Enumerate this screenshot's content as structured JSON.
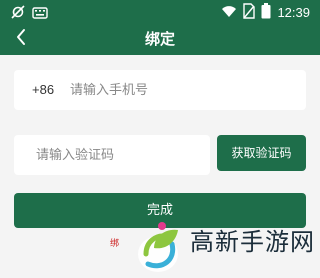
{
  "status_bar": {
    "time": "12:39",
    "icons": [
      "sync-off-icon",
      "keyboard-icon",
      "wifi-icon",
      "no-sim-icon",
      "battery-icon"
    ]
  },
  "app_bar": {
    "title": "绑定",
    "back_icon": "chevron-left-icon"
  },
  "phone_field": {
    "prefix": "+86",
    "placeholder": "请输入手机号",
    "value": ""
  },
  "code_field": {
    "placeholder": "请输入验证码",
    "value": ""
  },
  "get_code_button": "获取验证码",
  "done_button": "完成",
  "agreement_text": "绑",
  "watermark": {
    "text": "高新手游网",
    "logo_icon": "leaf-logo-icon"
  },
  "colors": {
    "primary": "#1e6e4a",
    "background": "#f4f4f4",
    "field_background": "#ffffff",
    "agreement_text": "#cc2222"
  }
}
